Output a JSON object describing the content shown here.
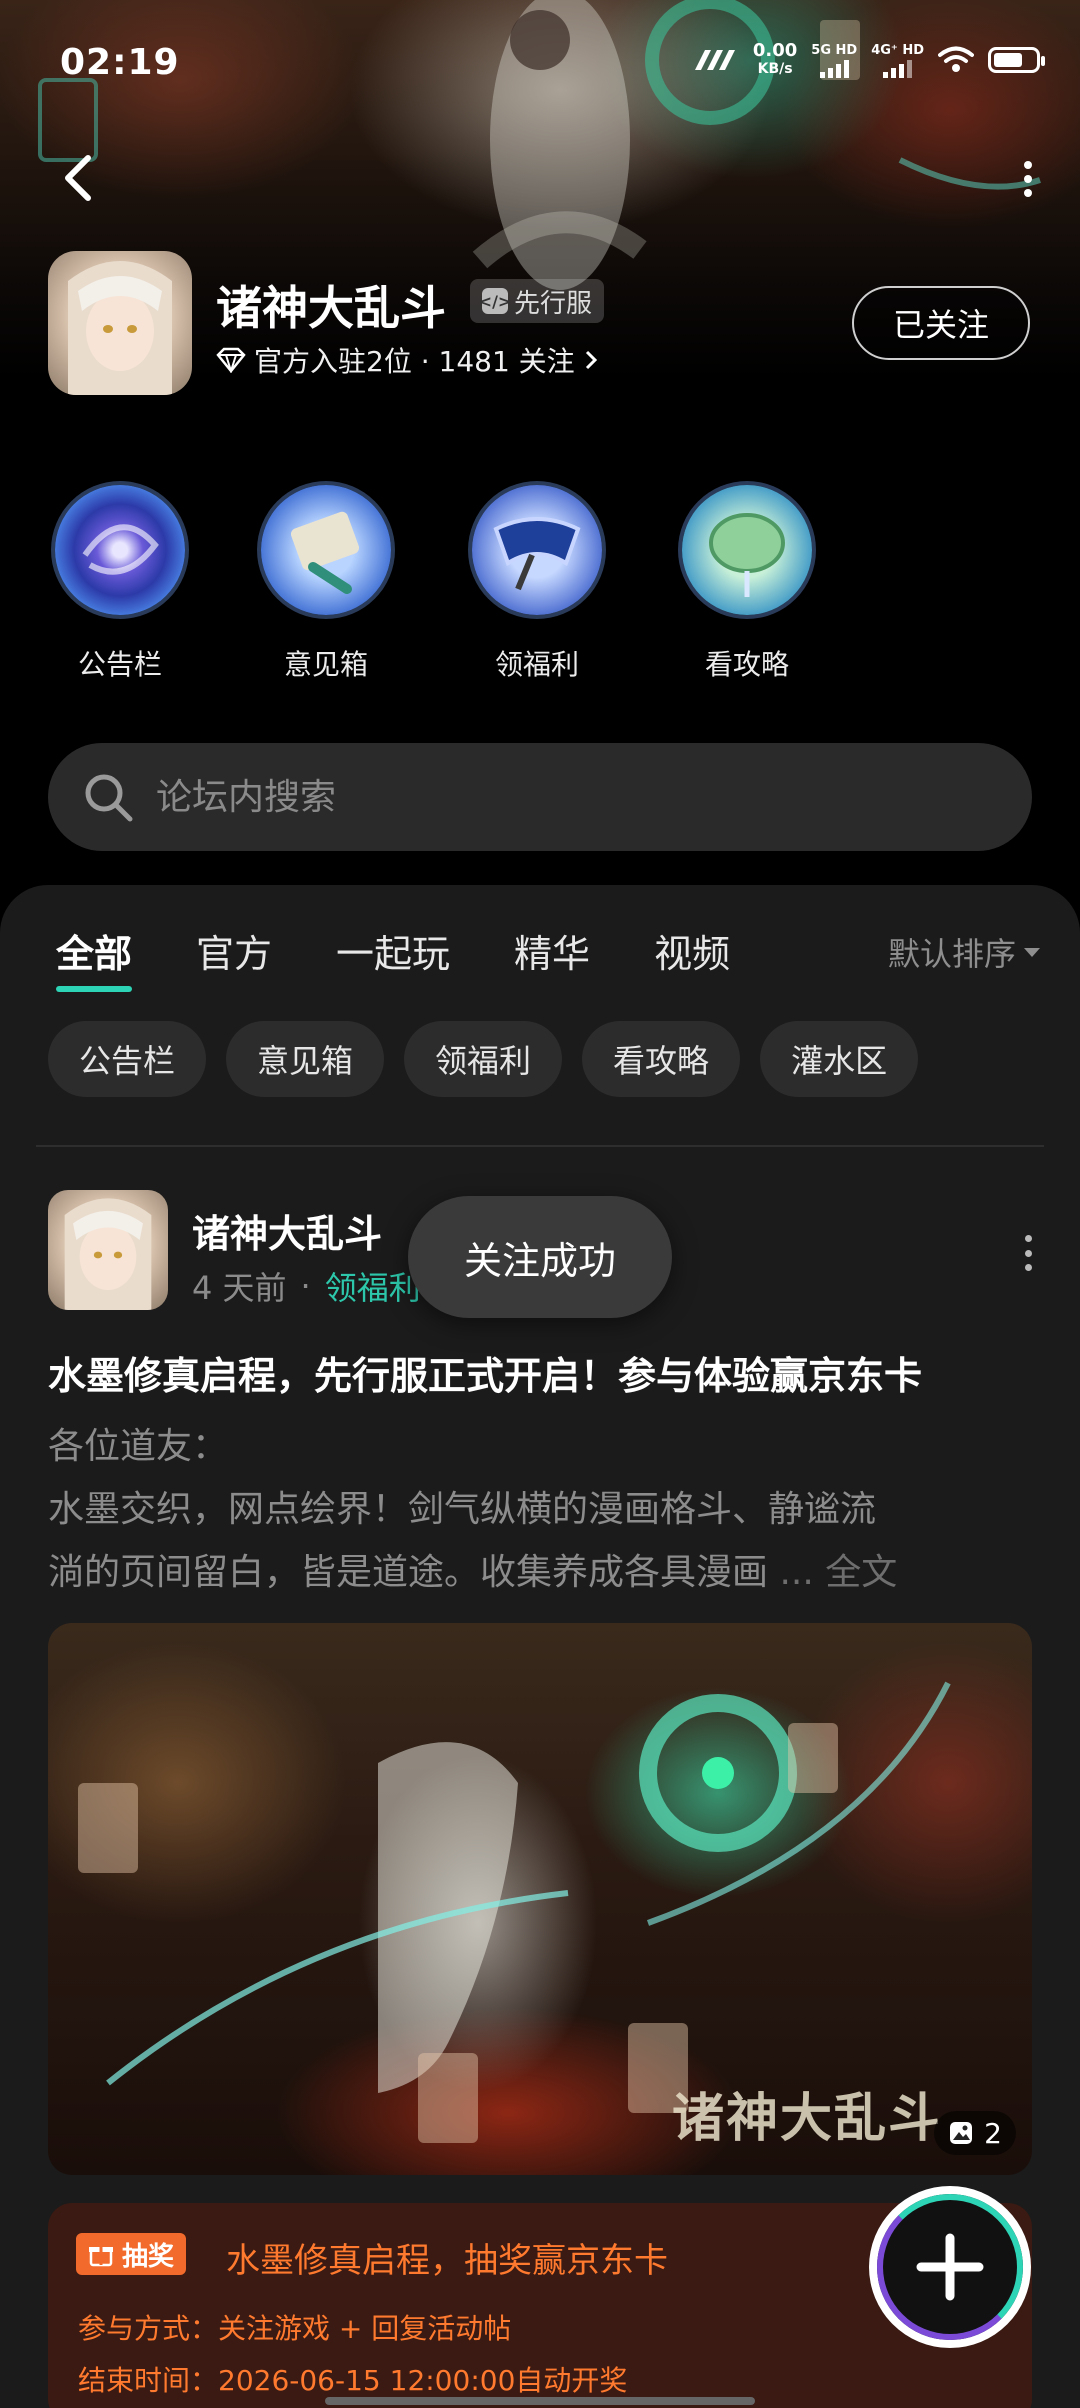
{
  "status_bar": {
    "time": "02:19",
    "net_speed_value": "0.00",
    "net_speed_unit": "KB/s",
    "sim1": "5G HD",
    "sim2": "4G⁺ HD"
  },
  "header": {
    "game_name": "诸神大乱斗",
    "server_badge": "先行服",
    "official_stats": "官方入驻2位 · 1481 关注",
    "follow_button": "已关注"
  },
  "quick_links": [
    {
      "label": "公告栏",
      "icon": "galaxy-orb-icon"
    },
    {
      "label": "意见箱",
      "icon": "scroll-orb-icon"
    },
    {
      "label": "领福利",
      "icon": "gift-orb-icon"
    },
    {
      "label": "看攻略",
      "icon": "jade-orb-icon"
    }
  ],
  "search": {
    "placeholder": "论坛内搜索"
  },
  "tabs": [
    {
      "label": "全部",
      "active": true
    },
    {
      "label": "官方"
    },
    {
      "label": "一起玩"
    },
    {
      "label": "精华"
    },
    {
      "label": "视频"
    }
  ],
  "sort_label": "默认排序",
  "chips": [
    "公告栏",
    "意见箱",
    "领福利",
    "看攻略",
    "灌水区"
  ],
  "post": {
    "author": "诸神大乱斗",
    "time": "4 天前",
    "category": "领福利",
    "title": "水墨修真启程，先行服正式开启！参与体验赢京东卡",
    "body_line1": "各位道友：",
    "body_line2": "水墨交织，网点绘界！剑气纵横的漫画格斗、静谧流",
    "body_line3": "淌的页间留白，皆是道途。收集养成各具漫画",
    "body_more": " ... 全文",
    "image_watermark": "诸神大乱斗",
    "image_count": "2"
  },
  "lottery": {
    "badge": "抽奖",
    "title": "水墨修真启程，抽奖赢京东卡",
    "method": "参与方式：关注游戏 + 回复活动帖",
    "end_time": "结束时间：2026-06-15 12:00:00自动开奖"
  },
  "toast": "关注成功",
  "colors": {
    "accent": "#2dd4b5",
    "lottery_orange": "#ff7a2e",
    "lottery_badge": "#f26b2c"
  }
}
